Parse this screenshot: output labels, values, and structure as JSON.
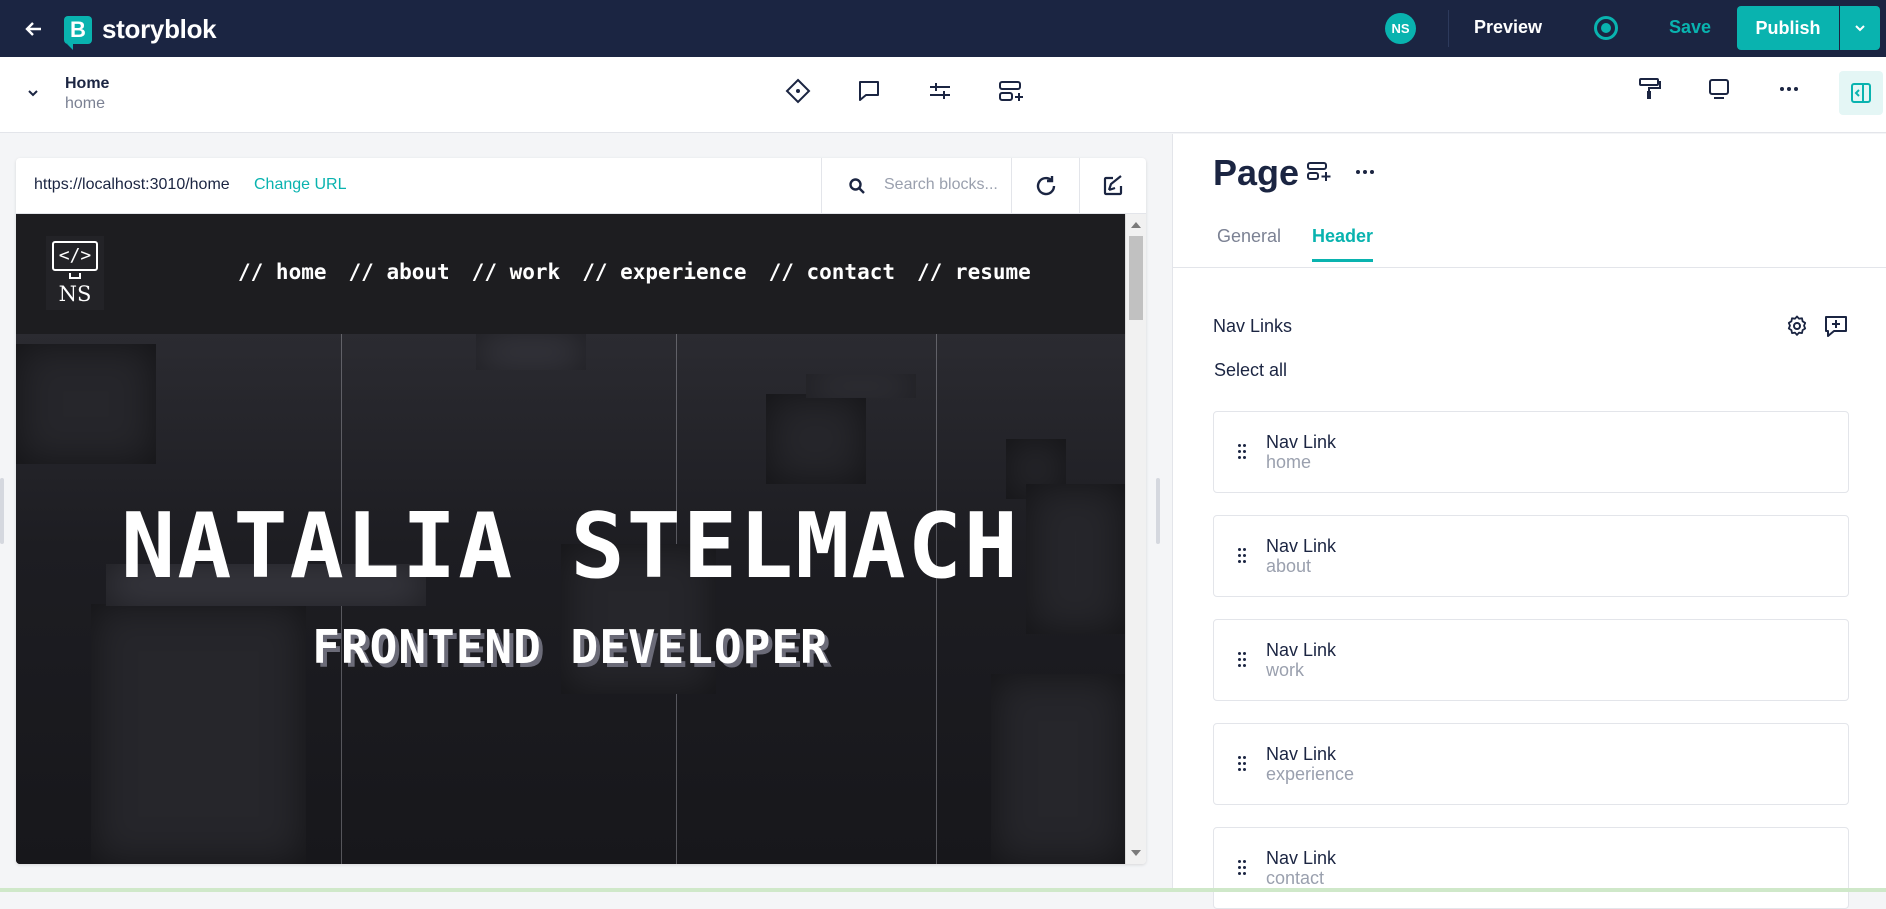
{
  "app": {
    "brand": "storyblok",
    "brand_letter": "B"
  },
  "topbar": {
    "avatar_initials": "NS",
    "preview_label": "Preview",
    "save_label": "Save",
    "publish_label": "Publish"
  },
  "story": {
    "name": "Home",
    "slug": "home"
  },
  "preview": {
    "url": "https://localhost:3010/home",
    "change_url_label": "Change URL",
    "search_placeholder": "Search blocks..."
  },
  "site": {
    "logo_code": "</>",
    "logo_initials": "NS",
    "nav": [
      "// home",
      "// about",
      "// work",
      "// experience",
      "// contact",
      "// resume"
    ],
    "hero_title": "NATALIA STELMACH",
    "hero_subtitle": "FRONTEND DEVELOPER"
  },
  "sidebar": {
    "title": "Page",
    "tabs": [
      {
        "label": "General",
        "active": false
      },
      {
        "label": "Header",
        "active": true
      }
    ],
    "field_label": "Nav Links",
    "select_all_label": "Select all",
    "items": [
      {
        "title": "Nav Link",
        "subtitle": "home"
      },
      {
        "title": "Nav Link",
        "subtitle": "about"
      },
      {
        "title": "Nav Link",
        "subtitle": "work"
      },
      {
        "title": "Nav Link",
        "subtitle": "experience"
      },
      {
        "title": "Nav Link",
        "subtitle": "contact"
      }
    ]
  },
  "colors": {
    "accent": "#09b3af",
    "topbar": "#1b2542"
  }
}
